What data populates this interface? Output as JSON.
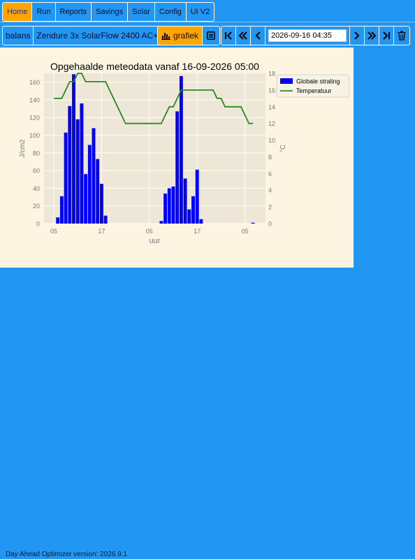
{
  "nav": {
    "items": [
      {
        "label": "Home",
        "active": true
      },
      {
        "label": "Run",
        "active": false
      },
      {
        "label": "Reports",
        "active": false
      },
      {
        "label": "Savings",
        "active": false
      },
      {
        "label": "Solar",
        "active": false
      },
      {
        "label": "Config",
        "active": false
      },
      {
        "label": "UI V2",
        "active": false
      }
    ]
  },
  "toolbar": {
    "balans_label": "balans",
    "device_label": "Zendure 3x SolarFlow 2400 AC+",
    "grafiek_label": "grafiek",
    "date_value": "2026-09-16 04:35"
  },
  "footer": {
    "version_text": "Day Ahead Optimizer version: 2026.9.1"
  },
  "colors": {
    "background": "#2196F3",
    "active": "#FFA500",
    "panel": "#FDF5E2",
    "plot_bg": "#EEE7D7",
    "bar": "#0000FF",
    "line": "#228B22"
  },
  "chart_data": {
    "type": "bar",
    "title": "Opgehaalde meteodata vanaf 16-09-2026 05:00",
    "xlabel": "uur",
    "ylabel": "J/cm2",
    "ylabel_right": "°C",
    "x_tick_labels": [
      "05",
      "17",
      "05",
      "17",
      "05"
    ],
    "ylim": [
      0,
      170
    ],
    "yticks": [
      0,
      20,
      40,
      60,
      80,
      100,
      120,
      140,
      160
    ],
    "ylim_right": [
      0,
      18
    ],
    "yticks_right": [
      0,
      2,
      4,
      6,
      8,
      10,
      12,
      14,
      16,
      18
    ],
    "grid": true,
    "legend_position": "top-right",
    "series": [
      {
        "name": "Globale straling",
        "kind": "bar",
        "values": [
          0,
          7,
          31,
          103,
          133,
          169,
          118,
          136,
          56,
          89,
          108,
          73,
          45,
          9,
          0,
          0,
          0,
          0,
          0,
          0,
          0,
          0,
          0,
          0,
          0,
          0,
          0,
          3,
          34,
          40,
          42,
          127,
          167,
          51,
          16,
          31,
          61,
          5,
          0,
          0,
          0,
          0,
          0,
          0,
          0,
          0,
          0,
          0,
          0,
          0,
          1
        ]
      },
      {
        "name": "Temperatuur",
        "kind": "line",
        "values": [
          15,
          15,
          15,
          16,
          17,
          17,
          18,
          18,
          17,
          17,
          17,
          17,
          17,
          17,
          16,
          15,
          14,
          13,
          12,
          12,
          12,
          12,
          12,
          12,
          12,
          12,
          12,
          12,
          13,
          14,
          14,
          15,
          16,
          16,
          16,
          16,
          16,
          16,
          16,
          16,
          16,
          15,
          15,
          14,
          14,
          14,
          14,
          14,
          13,
          12,
          12
        ]
      }
    ]
  }
}
